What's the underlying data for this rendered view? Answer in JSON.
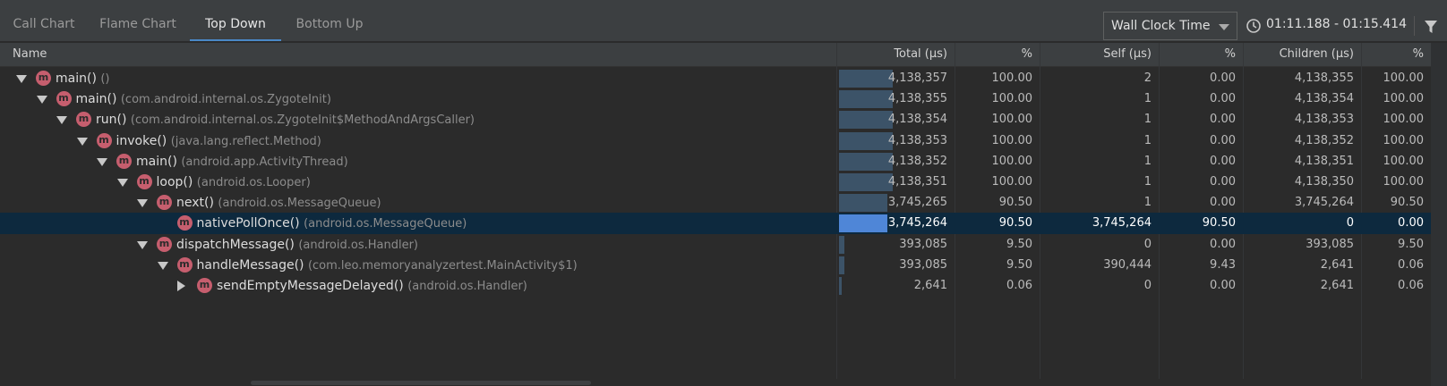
{
  "tabs": [
    {
      "label": "Call Chart",
      "active": false
    },
    {
      "label": "Flame Chart",
      "active": false
    },
    {
      "label": "Top Down",
      "active": true
    },
    {
      "label": "Bottom Up",
      "active": false
    }
  ],
  "clock_selector": {
    "value": "Wall Clock Time"
  },
  "time_range": "01:11.188 - 01:15.414",
  "columns": {
    "name": "Name",
    "total": "Total (µs)",
    "total_pct": "%",
    "self": "Self (µs)",
    "self_pct": "%",
    "children": "Children (µs)",
    "children_pct": "%"
  },
  "rows": [
    {
      "indent": 0,
      "expander": "down",
      "method": "main()",
      "cls": "()",
      "total": "4,138,357",
      "total_pct": "100.00",
      "total_fraction": 1.0,
      "self": "2",
      "self_pct": "0.00",
      "children": "4,138,355",
      "children_pct": "100.00"
    },
    {
      "indent": 1,
      "expander": "down",
      "method": "main()",
      "cls": "(com.android.internal.os.ZygoteInit)",
      "total": "4,138,355",
      "total_pct": "100.00",
      "total_fraction": 1.0,
      "self": "1",
      "self_pct": "0.00",
      "children": "4,138,354",
      "children_pct": "100.00"
    },
    {
      "indent": 2,
      "expander": "down",
      "method": "run()",
      "cls": "(com.android.internal.os.ZygoteInit$MethodAndArgsCaller)",
      "total": "4,138,354",
      "total_pct": "100.00",
      "total_fraction": 1.0,
      "self": "1",
      "self_pct": "0.00",
      "children": "4,138,353",
      "children_pct": "100.00"
    },
    {
      "indent": 3,
      "expander": "down",
      "method": "invoke()",
      "cls": "(java.lang.reflect.Method)",
      "total": "4,138,353",
      "total_pct": "100.00",
      "total_fraction": 1.0,
      "self": "1",
      "self_pct": "0.00",
      "children": "4,138,352",
      "children_pct": "100.00"
    },
    {
      "indent": 4,
      "expander": "down",
      "method": "main()",
      "cls": "(android.app.ActivityThread)",
      "total": "4,138,352",
      "total_pct": "100.00",
      "total_fraction": 1.0,
      "self": "1",
      "self_pct": "0.00",
      "children": "4,138,351",
      "children_pct": "100.00"
    },
    {
      "indent": 5,
      "expander": "down",
      "method": "loop()",
      "cls": "(android.os.Looper)",
      "total": "4,138,351",
      "total_pct": "100.00",
      "total_fraction": 1.0,
      "self": "1",
      "self_pct": "0.00",
      "children": "4,138,350",
      "children_pct": "100.00"
    },
    {
      "indent": 6,
      "expander": "down",
      "method": "next()",
      "cls": "(android.os.MessageQueue)",
      "total": "3,745,265",
      "total_pct": "90.50",
      "total_fraction": 0.905,
      "self": "1",
      "self_pct": "0.00",
      "children": "3,745,264",
      "children_pct": "90.50"
    },
    {
      "indent": 7,
      "expander": "none",
      "method": "nativePollOnce()",
      "cls": "(android.os.MessageQueue)",
      "total": "3,745,264",
      "total_pct": "90.50",
      "total_fraction": 0.905,
      "self": "3,745,264",
      "self_pct": "90.50",
      "children": "0",
      "children_pct": "0.00",
      "selected": true
    },
    {
      "indent": 6,
      "expander": "down",
      "method": "dispatchMessage()",
      "cls": "(android.os.Handler)",
      "total": "393,085",
      "total_pct": "9.50",
      "total_fraction": 0.095,
      "self": "0",
      "self_pct": "0.00",
      "children": "393,085",
      "children_pct": "9.50"
    },
    {
      "indent": 7,
      "expander": "down",
      "method": "handleMessage()",
      "cls": "(com.leo.memoryanalyzertest.MainActivity$1)",
      "total": "393,085",
      "total_pct": "9.50",
      "total_fraction": 0.095,
      "self": "390,444",
      "self_pct": "9.43",
      "children": "2,641",
      "children_pct": "0.06"
    },
    {
      "indent": 8,
      "expander": "right",
      "method": "sendEmptyMessageDelayed()",
      "cls": "(android.os.Handler)",
      "total": "2,641",
      "total_pct": "0.06",
      "total_fraction": 0.0006,
      "self": "0",
      "self_pct": "0.00",
      "children": "2,641",
      "children_pct": "0.06"
    }
  ]
}
